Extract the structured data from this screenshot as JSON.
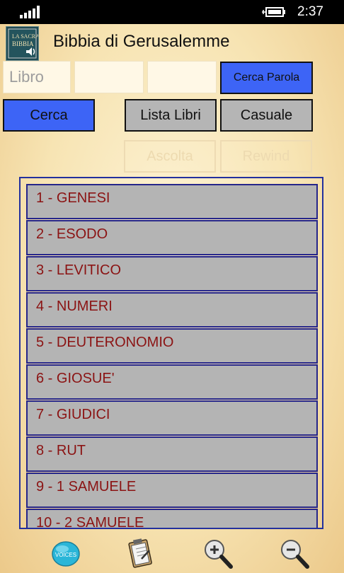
{
  "status_bar": {
    "time": "2:37"
  },
  "app": {
    "title": "Bibbia di Gerusalemme",
    "icon_text_top": "LA SACRA",
    "icon_text_bottom": "BIBBIA"
  },
  "search": {
    "libro_placeholder": "Libro",
    "chapter_value": "",
    "verse_value": ""
  },
  "buttons": {
    "cerca_parola": "Cerca Parola",
    "cerca": "Cerca",
    "lista_libri": "Lista Libri",
    "casuale": "Casuale",
    "ascolta": "Ascolta",
    "rewind": "Rewind"
  },
  "books": [
    "1 - GENESI",
    "2 - ESODO",
    "3 - LEVITICO",
    "4 - NUMERI",
    "5 - DEUTERONOMIO",
    "6 - GIOSUE'",
    "7 - GIUDICI",
    "8 - RUT",
    "9 - 1 SAMUELE",
    "10 - 2 SAMUELE"
  ],
  "bottom_bar": {
    "icons": [
      "voices-icon",
      "notes-icon",
      "zoom-in-icon",
      "zoom-out-icon"
    ],
    "voices_label": "VOICES"
  },
  "colors": {
    "accent_blue": "#3d64f6",
    "button_grey": "#b5b5b5",
    "list_text": "#8b1313",
    "list_border": "#25258a"
  }
}
